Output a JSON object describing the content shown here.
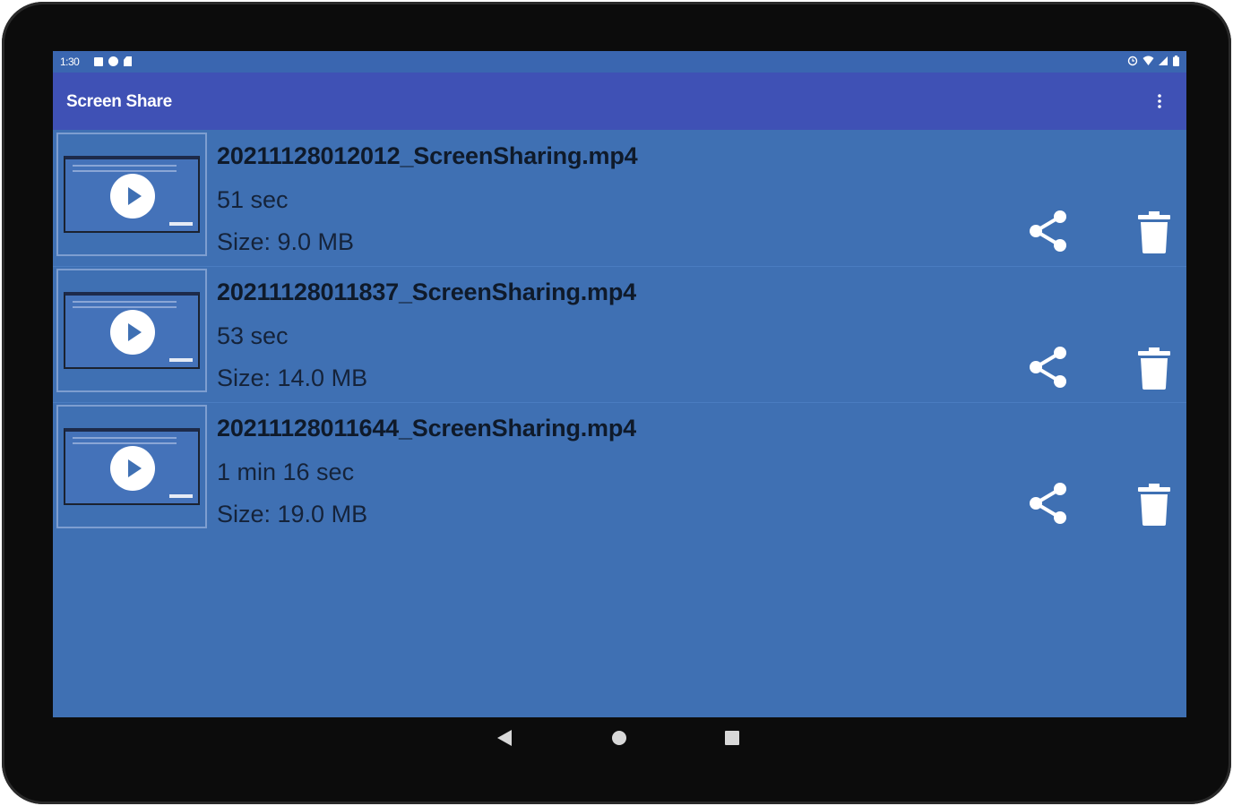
{
  "status_bar": {
    "time": "1:30",
    "left_icons": [
      "notification-square-icon",
      "vpn-icon",
      "sd-card-icon"
    ],
    "right_icons": [
      "alarm-icon",
      "wifi-icon",
      "signal-icon",
      "battery-icon"
    ]
  },
  "app_bar": {
    "title": "Screen Share",
    "menu_icon": "more-vert-icon"
  },
  "recordings": [
    {
      "name": "20211128012012_ScreenSharing.mp4",
      "duration": "51 sec",
      "size": "Size: 9.0 MB"
    },
    {
      "name": "20211128011837_ScreenSharing.mp4",
      "duration": "53 sec",
      "size": "Size: 14.0 MB"
    },
    {
      "name": "20211128011644_ScreenSharing.mp4",
      "duration": "1 min 16 sec",
      "size": "Size: 19.0 MB"
    }
  ],
  "actions": {
    "share_icon": "share-icon",
    "delete_icon": "trash-icon"
  },
  "nav_bar": {
    "buttons": [
      "back-icon",
      "home-icon",
      "recents-icon"
    ]
  },
  "colors": {
    "status_bar": "#3a66b0",
    "app_bar": "#3f51b5",
    "list_background": "#3f70b3",
    "text_primary": "#0f1a2a",
    "device_frame": "#0c0c0c"
  }
}
